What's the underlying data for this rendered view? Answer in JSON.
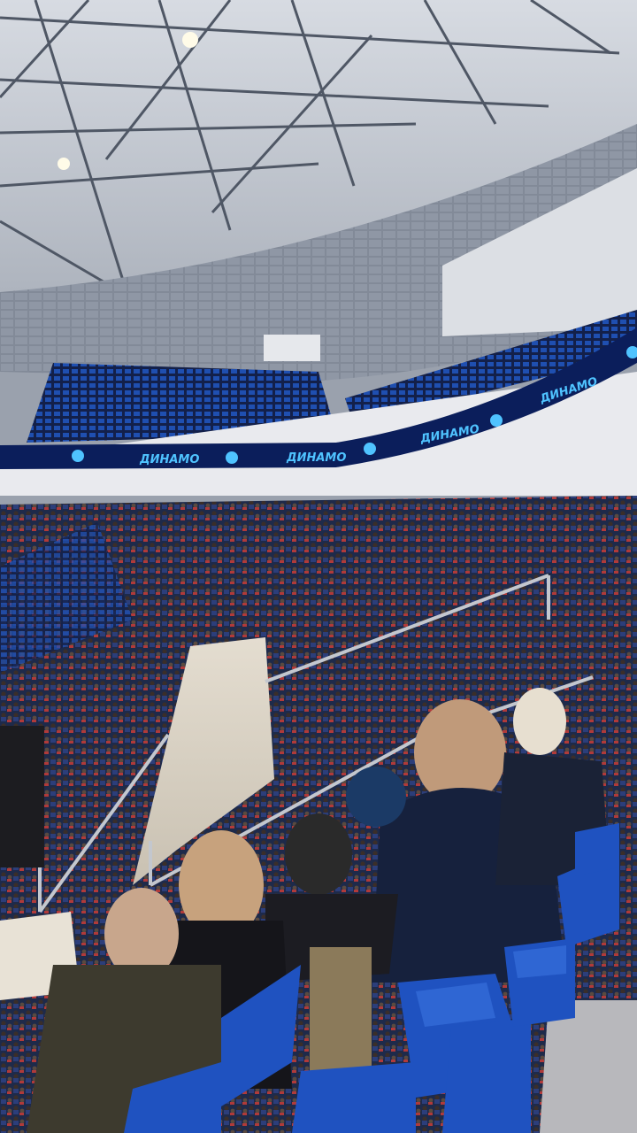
{
  "scene": {
    "type": "arena-interior-photo",
    "colors": {
      "roof": "#c9ced6",
      "truss": "#5a6270",
      "upper_wall": "#8c94a3",
      "led_ribbon": "#0b1e5b",
      "led_text": "#4fc3ff",
      "seat_blue": "#1f4fb0",
      "floor": "#d9d2c4",
      "railing": "#b8bcc4"
    }
  },
  "led_board": {
    "brand_text": "ДИНАМО",
    "icon": "snowflake-logo-icon"
  }
}
